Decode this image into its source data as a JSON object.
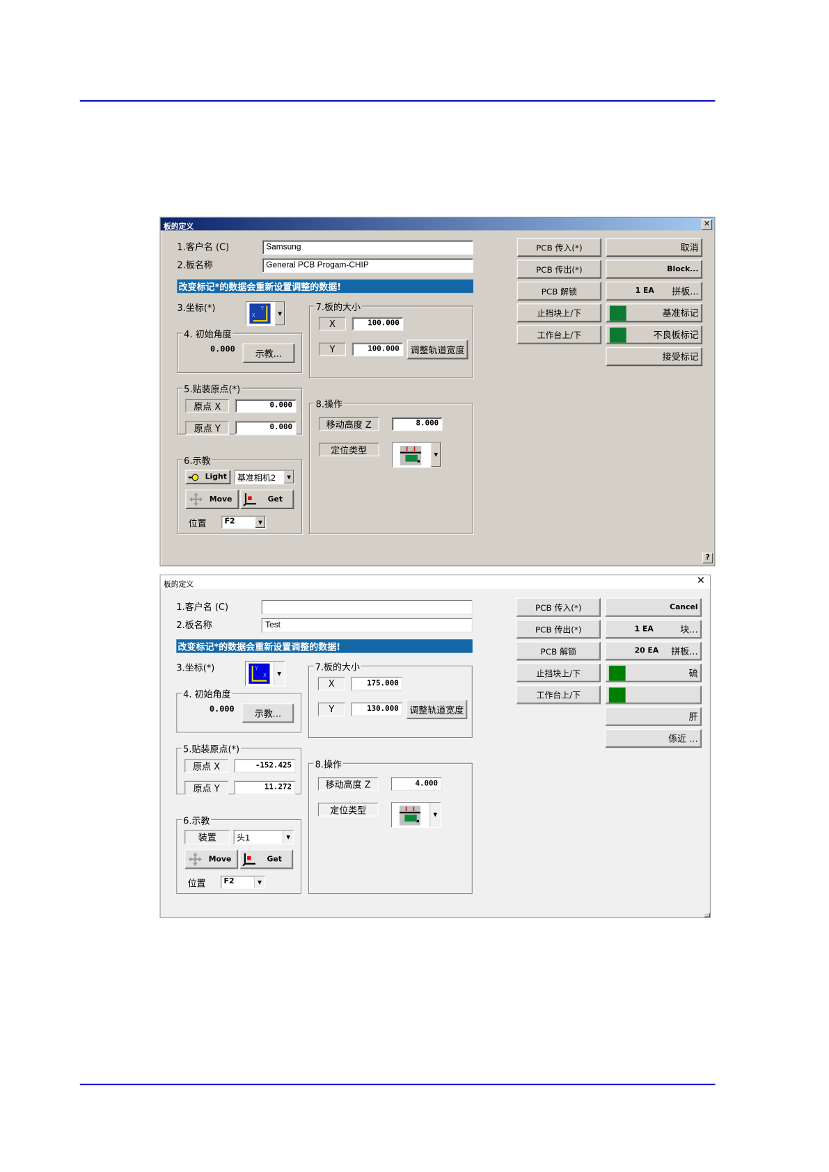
{
  "page": {
    "rule_color": "#1010d0"
  },
  "dialogs": [
    {
      "theme": "classic",
      "title": "板的定义",
      "close": "✕",
      "customer_label": "1.客户名 (C)",
      "customer_value": "Samsung",
      "board_label": "2.板名称",
      "board_value": "General PCB Progam-CHIP",
      "banner": "改变标记*的数据会重新设置调整的数据!",
      "coord_label": "3.坐标(*)",
      "angle": {
        "title": "4. 初始角度",
        "value": "0.000",
        "teach": "示教..."
      },
      "origin": {
        "title": "5.贴装原点(*)",
        "x_label": "原点 X",
        "x_value": "0.000",
        "y_label": "原点 Y",
        "y_value": "0.000"
      },
      "teach": {
        "title": "6.示教",
        "light": "Light",
        "camera": "基准相机2",
        "move": "Move",
        "get": "Get",
        "pos_label": "位置",
        "pos_value": "F2"
      },
      "size": {
        "title": "7.板的大小",
        "x_label": "X",
        "x_value": "100.000",
        "y_label": "Y",
        "y_value": "100.000",
        "adjust": "调整轨道宽度"
      },
      "op": {
        "title": "8.操作",
        "z_label": "移动高度 Z",
        "z_value": "8.000",
        "type_label": "定位类型"
      },
      "left_buttons": [
        "PCB 传入(*)",
        "PCB 传出(*)",
        "PCB 解锁",
        "止挡块上/下",
        "工作台上/下"
      ],
      "right_buttons": [
        {
          "text": "取消"
        },
        {
          "text": "Block..."
        },
        {
          "prefix": "1 EA",
          "text": "拼板..."
        },
        {
          "green": true,
          "text": "基准标记"
        },
        {
          "green": true,
          "text": "不良板标记"
        },
        {
          "text": "接受标记"
        }
      ],
      "help": "?",
      "colors": {
        "background": "#d4d0c8",
        "banner": "#1468a8",
        "mark": "#0d7a32"
      }
    },
    {
      "theme": "modern",
      "title": "板的定义",
      "close": "✕",
      "customer_label": "1.客户名 (C)",
      "customer_value": "",
      "board_label": "2.板名称",
      "board_value": "Test",
      "banner": "改变标记*的数据会重新设置调整的数据!",
      "coord_label": "3.坐标(*)",
      "angle": {
        "title": "4. 初始角度",
        "value": "0.000",
        "teach": "示教..."
      },
      "origin": {
        "title": "5.贴装原点(*)",
        "x_label": "原点 X",
        "x_value": "-152.425",
        "y_label": "原点 Y",
        "y_value": "11.272"
      },
      "teach": {
        "title": "6.示教",
        "device_label": "装置",
        "device_value": "头1",
        "move": "Move",
        "get": "Get",
        "pos_label": "位置",
        "pos_value": "F2"
      },
      "size": {
        "title": "7.板的大小",
        "x_label": "X",
        "x_value": "175.000",
        "y_label": "Y",
        "y_value": "130.000",
        "adjust": "调整轨道宽度"
      },
      "op": {
        "title": "8.操作",
        "z_label": "移动高度 Z",
        "z_value": "4.000",
        "type_label": "定位类型"
      },
      "left_buttons": [
        "PCB 传入(*)",
        "PCB 传出(*)",
        "PCB 解锁",
        "止挡块上/下",
        "工作台上/下"
      ],
      "right_buttons": [
        {
          "text": "Cancel"
        },
        {
          "prefix": "1 EA",
          "text": "块..."
        },
        {
          "prefix": "20 EA",
          "text": "拼板..."
        },
        {
          "green": true,
          "text": "硫"
        },
        {
          "green": true,
          "text": ""
        },
        {
          "text": "肝"
        },
        {
          "text": "係近 ..."
        }
      ],
      "colors": {
        "background": "#f0f0f0",
        "banner": "#1468a8",
        "mark": "#008000"
      }
    }
  ]
}
